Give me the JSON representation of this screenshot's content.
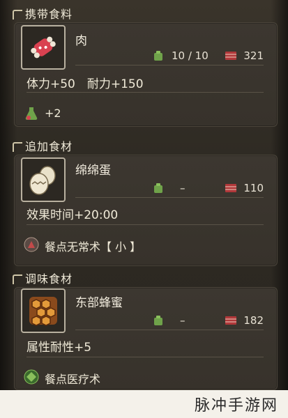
{
  "sections": [
    {
      "title": "携带食料",
      "item": {
        "name": "肉",
        "qty": "10 / 10",
        "stock": "321"
      },
      "effect": "体力+50　耐力+150",
      "skill": {
        "icon": "green-flask-icon",
        "text": "+2"
      }
    },
    {
      "title": "追加食材",
      "item": {
        "name": "绵绵蛋",
        "qty": "–",
        "stock": "110"
      },
      "effect": "效果时间+20:00",
      "skill": {
        "icon": "red-badge-icon",
        "text": "餐点无常术【 小 】"
      }
    },
    {
      "title": "调味食材",
      "item": {
        "name": "东部蜂蜜",
        "qty": "–",
        "stock": "182"
      },
      "effect": "属性耐性+5",
      "skill": {
        "icon": "green-diamond-icon",
        "text": "餐点医疗术"
      }
    }
  ],
  "watermark": "脉冲手游网",
  "colors": {
    "bag_green": "#6fa24a",
    "box_red": "#b0383a",
    "meat_red": "#d94150",
    "egg": "#e9e1c9",
    "honey": "#d9882f"
  }
}
